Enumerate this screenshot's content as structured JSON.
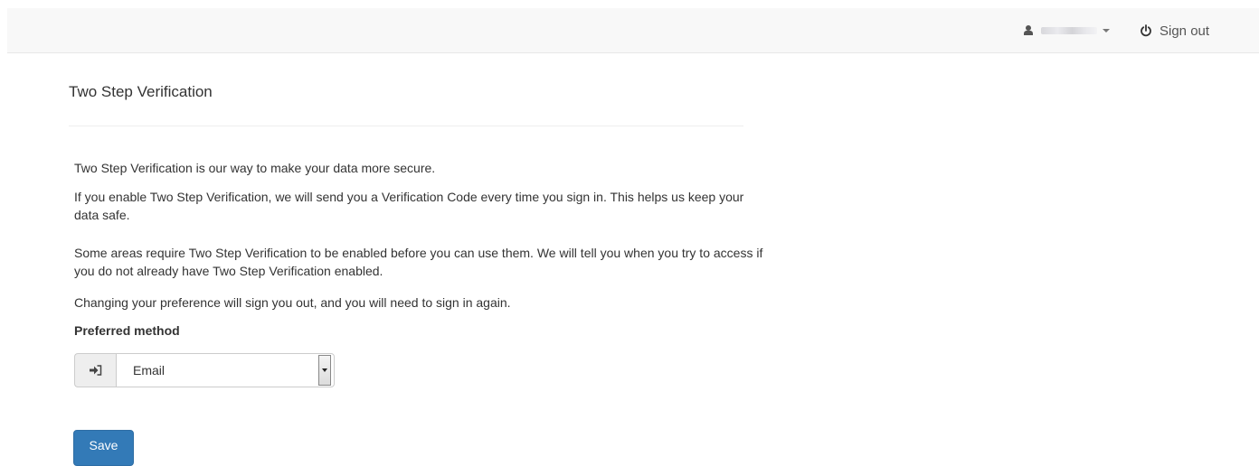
{
  "navbar": {
    "user_name": "••••••",
    "sign_out_label": "Sign out"
  },
  "main": {
    "title": "Two Step Verification",
    "paragraphs": [
      "Two Step Verification is our way to make your data more secure.",
      "If you enable Two Step Verification, we will send you a Verification Code every time you sign in. This helps us keep your data safe.",
      "Some areas require Two Step Verification to be enabled before you can use them. We will tell you when you try to access if you do not already have Two Step Verification enabled.",
      "Changing your preference will sign you out, and you will need to sign in again."
    ],
    "preferred_method_label": "Preferred method",
    "preferred_method_value": "Email",
    "save_label": "Save"
  },
  "colors": {
    "primary": "#337ab7",
    "navbar_bg": "#f8f8f8"
  },
  "icons": {
    "user": "user-icon",
    "caret": "caret-down-icon",
    "sign_out": "power-icon",
    "method_addon": "sign-in-icon"
  }
}
